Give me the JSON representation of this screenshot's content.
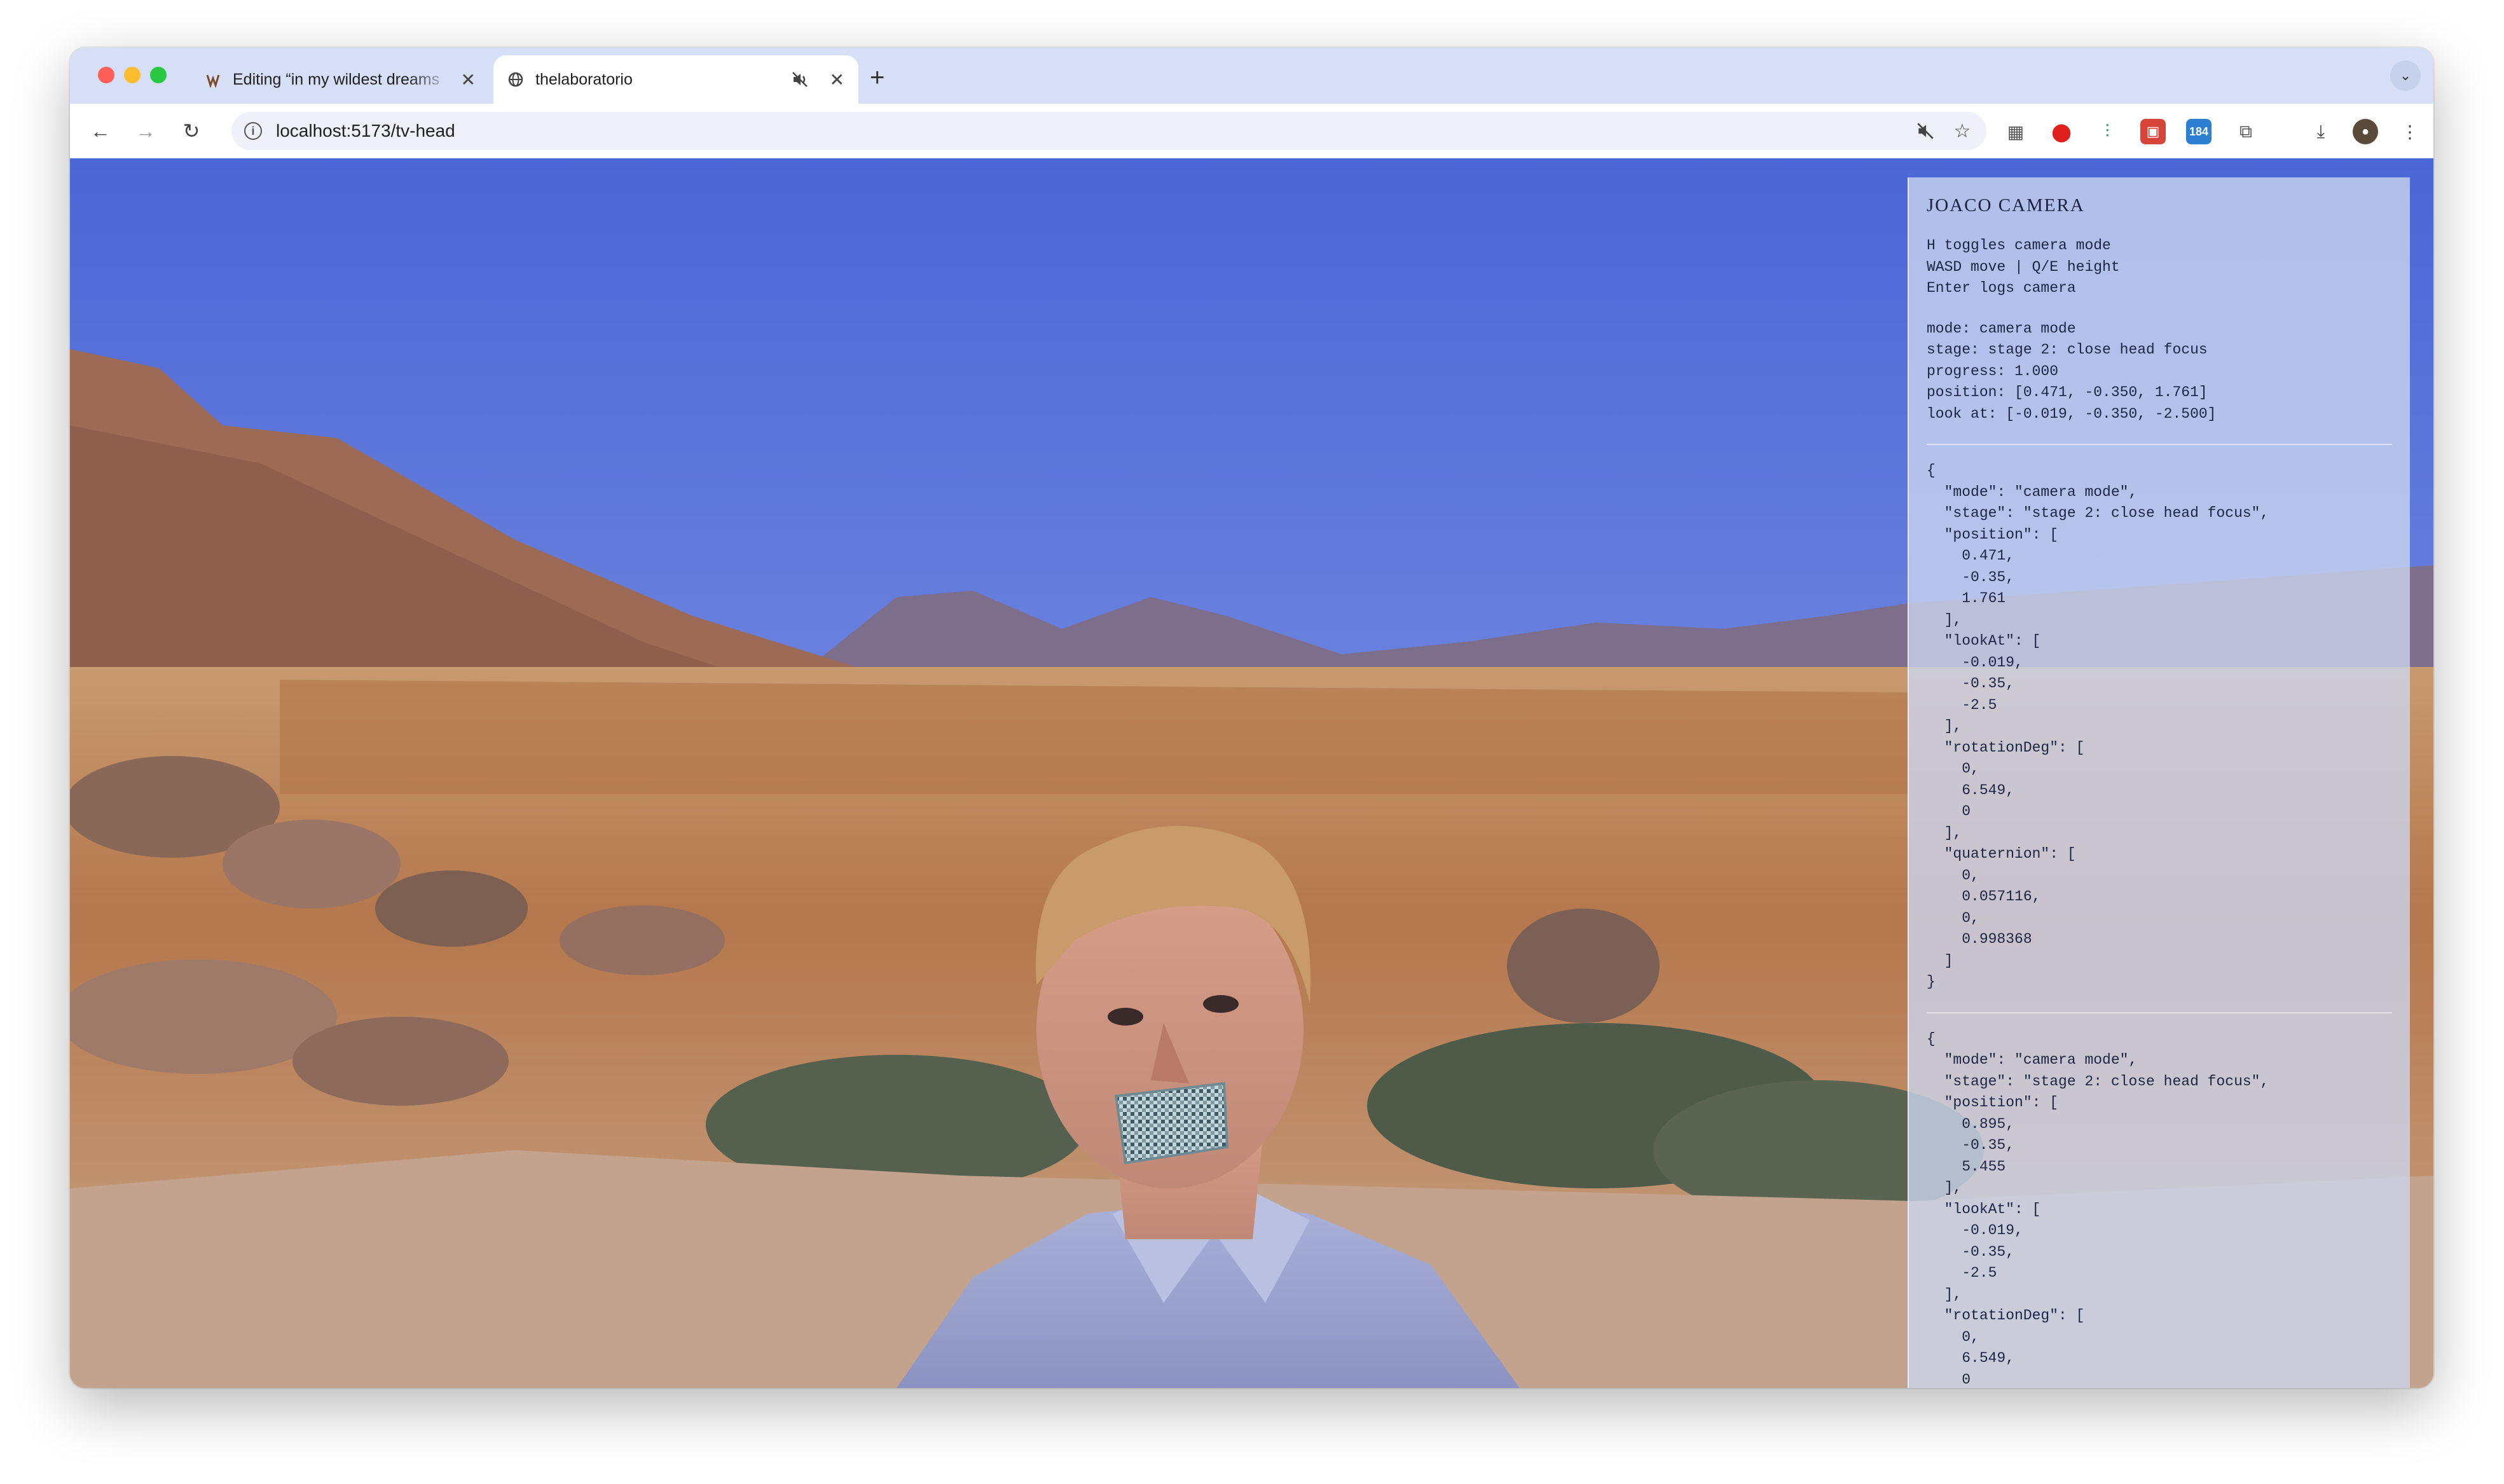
{
  "browser": {
    "tabs": [
      {
        "title": "Editing “in my wildest dreams",
        "favicon": "wordpress-favicon",
        "active": false
      },
      {
        "title": "thelaboratorio",
        "favicon": "globe-icon",
        "active": true
      }
    ],
    "new_tab": "+",
    "tab_close": "✕",
    "url": "localhost:5173/tv-head",
    "extension_badge": "184"
  },
  "panel": {
    "title": "JOACO CAMERA",
    "help": "H toggles camera mode\nWASD move | Q/E height\nEnter logs camera",
    "status": "mode: camera mode\nstage: stage 2: close head focus\nprogress: 1.000\nposition: [0.471, -0.350, 1.761]\nlook at: [-0.019, -0.350, -2.500]",
    "log1": "{\n  \"mode\": \"camera mode\",\n  \"stage\": \"stage 2: close head focus\",\n  \"position\": [\n    0.471,\n    -0.35,\n    1.761\n  ],\n  \"lookAt\": [\n    -0.019,\n    -0.35,\n    -2.5\n  ],\n  \"rotationDeg\": [\n    0,\n    6.549,\n    0\n  ],\n  \"quaternion\": [\n    0,\n    0.057116,\n    0,\n    0.998368\n  ]\n}",
    "log2": "{\n  \"mode\": \"camera mode\",\n  \"stage\": \"stage 2: close head focus\",\n  \"position\": [\n    0.895,\n    -0.35,\n    5.455\n  ],\n  \"lookAt\": [\n    -0.019,\n    -0.35,\n    -2.5\n  ],\n  \"rotationDeg\": [\n    0,\n    6.549,\n    0\n  ],"
  },
  "colors": {
    "sky_top": "#4a6ad8",
    "sky_bottom": "#8ea2e6",
    "ground": "#b98157",
    "tab_strip": "#d6dff5"
  }
}
